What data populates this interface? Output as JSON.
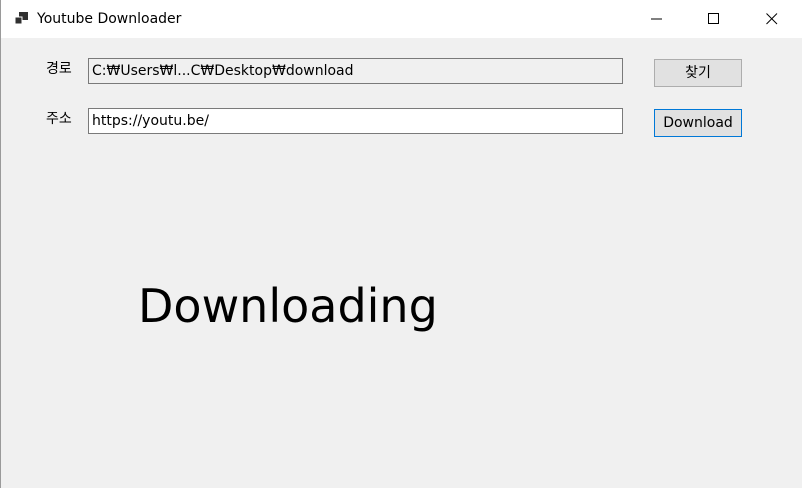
{
  "window": {
    "title": "Youtube Downloader",
    "icon": "app-window-icon",
    "controls": {
      "minimize_icon": "minimize-icon",
      "maximize_icon": "maximize-icon",
      "close_icon": "close-icon"
    }
  },
  "form": {
    "path_label": "경로",
    "path_value": "C:₩Users₩l...C₩Desktop₩download",
    "browse_label": "찾기",
    "url_label": "주소",
    "url_value": "https://youtu.be/",
    "download_label": "Download"
  },
  "status": {
    "text": "Downloading"
  },
  "colors": {
    "window_bg": "#f0f0f0",
    "titlebar_bg": "#ffffff",
    "focus_border": "#0078d7"
  }
}
